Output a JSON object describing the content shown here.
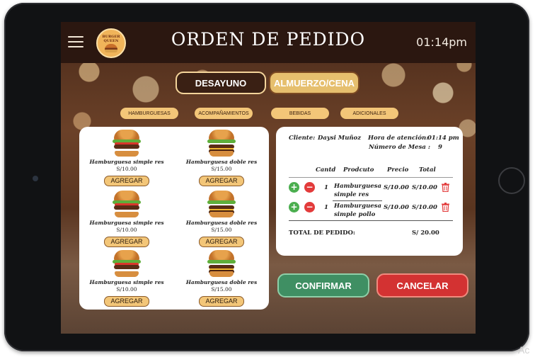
{
  "header": {
    "title": "ORDEN DE PEDIDO",
    "time": "01:14pm",
    "logo_text": "BURGER QUEEN"
  },
  "meal_tabs": [
    {
      "label": "DESAYUNO"
    },
    {
      "label": "ALMUERZO/CENA"
    }
  ],
  "categories": [
    {
      "label": "HAMBURGUESAS"
    },
    {
      "label": "ACOMPAÑAMIENTOS"
    },
    {
      "label": "BEBIDAS"
    },
    {
      "label": "ADICIONALES"
    }
  ],
  "menu": {
    "add_label": "AGREGAR",
    "items": [
      {
        "name": "Hamburguesa simple res",
        "price": "S/10.00"
      },
      {
        "name": "Hamburguesa doble res",
        "price": "S/15.00"
      },
      {
        "name": "Hamburguesa simple res",
        "price": "S/10.00"
      },
      {
        "name": "Hamburguesa doble res",
        "price": "S/15.00"
      },
      {
        "name": "Hamburguesa simple res",
        "price": "S/10.00"
      },
      {
        "name": "Hamburguesa doble res",
        "price": "S/15.00"
      }
    ]
  },
  "order": {
    "client_label": "Cliente:",
    "client_name": "Daysi Muñoz",
    "time_label": "Hora de atención:",
    "time_value": "01:14 pm",
    "table_label": "Número de Mesa :",
    "table_value": "9",
    "columns": [
      "Cantd",
      "Prodcuto",
      "Precio",
      "Total"
    ],
    "rows": [
      {
        "qty": "1",
        "product": "Hamburguesa simple res",
        "price": "S/10.00",
        "total": "S/10.00"
      },
      {
        "qty": "1",
        "product": "Hamburguesa simple pollo",
        "price": "S/10.00",
        "total": "S/10.00"
      }
    ],
    "total_label": "TOTAL DE PEDIDO:",
    "total_value": "S/ 20.00"
  },
  "actions": {
    "confirm": "CONFIRMAR",
    "cancel": "CANCELAR"
  },
  "watermark": "Ac",
  "colors": {
    "accent_gold": "#f3c678",
    "confirm_green": "#3f8f63",
    "cancel_red": "#d33232",
    "topbar": "#2b1710"
  }
}
